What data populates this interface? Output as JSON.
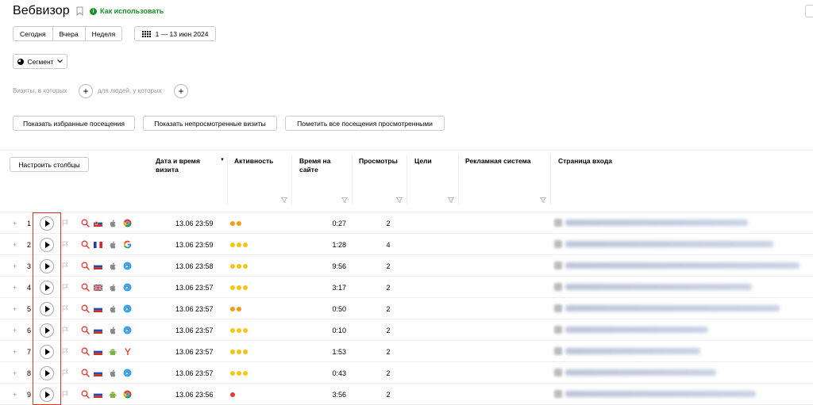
{
  "header": {
    "title": "Вебвизор",
    "howto": "Как использовать",
    "period_tabs": [
      "Сегодня",
      "Вчера",
      "Неделя"
    ],
    "date_range": "1 — 13 июн 2024",
    "segment": "Сегмент"
  },
  "filters": {
    "visits_label": "Визиты, в которых",
    "people_label": "для людей, у которых"
  },
  "actions": {
    "favorites": "Показать избранные посещения",
    "unviewed": "Показать непросмотренные визиты",
    "mark_all": "Пометить все посещения просмотренными"
  },
  "table": {
    "configure": "Настроить столбцы",
    "columns": {
      "datetime": "Дата и время визита",
      "activity": "Активность",
      "duration": "Время на сайте",
      "views": "Просмотры",
      "goals": "Цели",
      "ad_system": "Рекламная система",
      "entry_page": "Страница входа"
    },
    "rows": [
      {
        "n": "1",
        "country": "sk",
        "os": "apple",
        "browser": "chrome",
        "dt": "13.06 23:59",
        "act": [
          "#f39c1a",
          "#f39c1a"
        ],
        "dur": "0:27",
        "views": "2",
        "w": 230
      },
      {
        "n": "2",
        "country": "fr",
        "os": "apple",
        "browser": "google",
        "dt": "13.06 23:59",
        "act": [
          "#f5c518",
          "#f5c518",
          "#f5c518"
        ],
        "dur": "1:28",
        "views": "4",
        "w": 262
      },
      {
        "n": "3",
        "country": "ru",
        "os": "apple",
        "browser": "safari",
        "dt": "13.06 23:58",
        "act": [
          "#f5c518",
          "#f5c518",
          "#f5c518"
        ],
        "dur": "9:56",
        "views": "2",
        "w": 295
      },
      {
        "n": "4",
        "country": "uk",
        "os": "apple",
        "browser": "safari",
        "dt": "13.06 23:57",
        "act": [
          "#f5c518",
          "#f5c518",
          "#f5c518"
        ],
        "dur": "3:17",
        "views": "2",
        "w": 235
      },
      {
        "n": "5",
        "country": "ru",
        "os": "apple",
        "browser": "safari",
        "dt": "13.06 23:57",
        "act": [
          "#f39c1a",
          "#f39c1a"
        ],
        "dur": "0:50",
        "views": "2",
        "w": 270
      },
      {
        "n": "6",
        "country": "ru",
        "os": "apple",
        "browser": "safari",
        "dt": "13.06 23:57",
        "act": [
          "#f5c518",
          "#f5c518",
          "#f5c518"
        ],
        "dur": "0:10",
        "views": "2",
        "w": 180
      },
      {
        "n": "7",
        "country": "ru",
        "os": "android",
        "browser": "yandex",
        "dt": "13.06 23:57",
        "act": [
          "#f5c518",
          "#f5c518",
          "#f5c518"
        ],
        "dur": "1:53",
        "views": "2",
        "w": 170
      },
      {
        "n": "8",
        "country": "ru",
        "os": "apple",
        "browser": "safari",
        "dt": "13.06 23:57",
        "act": [
          "#f5c518",
          "#f5c518",
          "#f5c518"
        ],
        "dur": "0:43",
        "views": "2",
        "w": 190
      },
      {
        "n": "9",
        "country": "ru",
        "os": "android",
        "browser": "chrome",
        "dt": "13.06 23:56",
        "act": [
          "#e8382f"
        ],
        "dur": "3:56",
        "views": "2",
        "w": 240
      }
    ]
  }
}
